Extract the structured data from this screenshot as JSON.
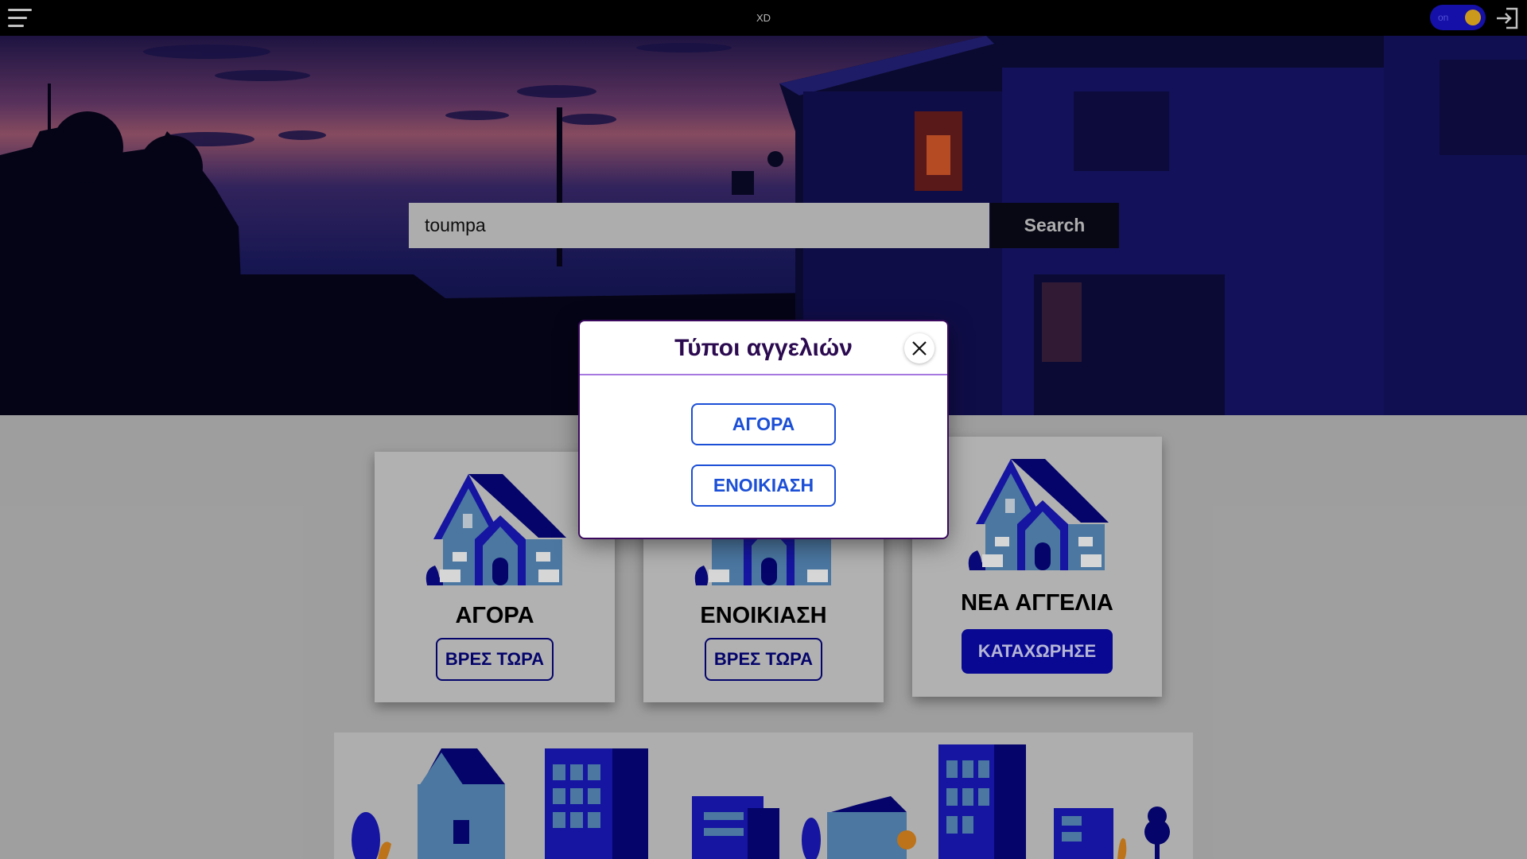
{
  "topbar": {
    "title": "XD",
    "toggle_label": "on"
  },
  "search": {
    "value": "toumpa",
    "button_label": "Search"
  },
  "cards": [
    {
      "title": "ΑΓΟΡΑ",
      "button_label": "ΒΡΕΣ ΤΩΡΑ"
    },
    {
      "title": "ΕΝΟΙΚΙΑΣΗ",
      "button_label": "ΒΡΕΣ ΤΩΡΑ"
    },
    {
      "title": "ΝΕΑ ΑΓΓΕΛΙΑ",
      "button_label": "ΚΑΤΑΧΩΡΗΣΕ"
    }
  ],
  "modal": {
    "title": "Τύποι αγγελιών",
    "options": [
      "ΑΓΟΡΑ",
      "ΕΝΟΙΚΙΑΣΗ"
    ]
  },
  "colors": {
    "accent": "#0a0ab0",
    "toggle": "#1a14c8",
    "toggle_knob": "#f2b823",
    "modal_divider": "#a779e0"
  }
}
